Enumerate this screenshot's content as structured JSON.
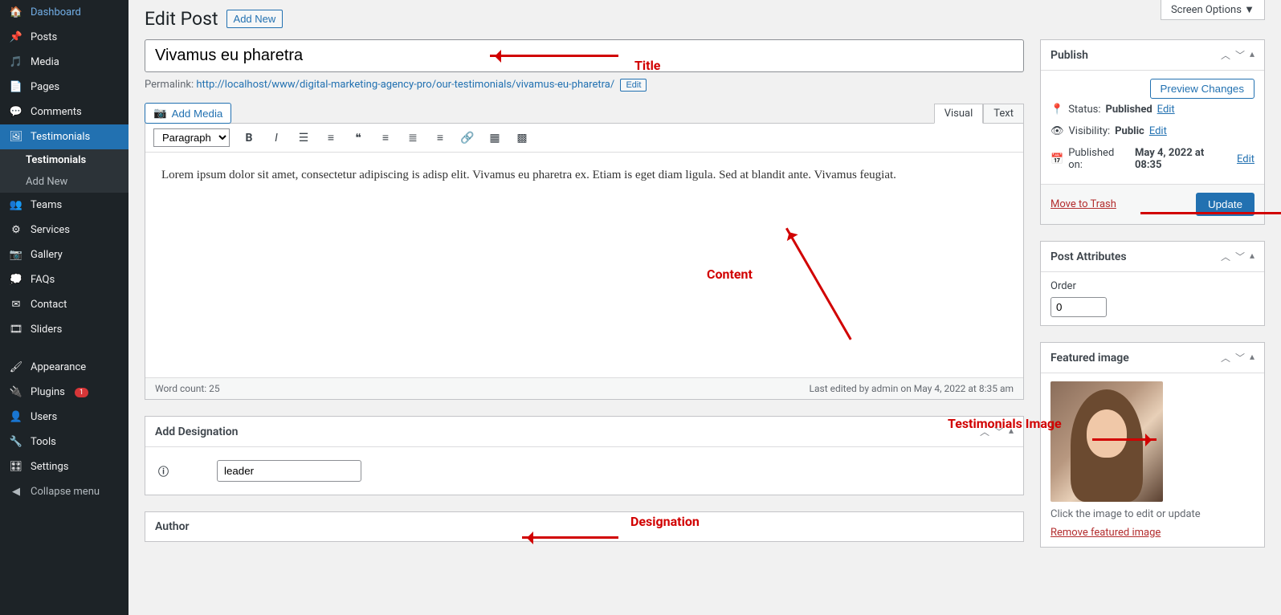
{
  "screen_options": "Screen Options ▼",
  "sidebar": {
    "items": [
      {
        "icon": "dash",
        "label": "Dashboard"
      },
      {
        "icon": "pin",
        "label": "Posts"
      },
      {
        "icon": "media",
        "label": "Media"
      },
      {
        "icon": "page",
        "label": "Pages"
      },
      {
        "icon": "comment",
        "label": "Comments"
      },
      {
        "icon": "test",
        "label": "Testimonials",
        "active": true
      },
      {
        "icon": "team",
        "label": "Teams"
      },
      {
        "icon": "serv",
        "label": "Services"
      },
      {
        "icon": "gall",
        "label": "Gallery"
      },
      {
        "icon": "faq",
        "label": "FAQs"
      },
      {
        "icon": "mail",
        "label": "Contact"
      },
      {
        "icon": "slide",
        "label": "Sliders"
      },
      {
        "icon": "appear",
        "label": "Appearance"
      },
      {
        "icon": "plugin",
        "label": "Plugins",
        "badge": "1"
      },
      {
        "icon": "user",
        "label": "Users"
      },
      {
        "icon": "tool",
        "label": "Tools"
      },
      {
        "icon": "set",
        "label": "Settings"
      }
    ],
    "submenu": [
      "Testimonials",
      "Add New"
    ],
    "collapse": "Collapse menu"
  },
  "header": {
    "title": "Edit Post",
    "add_new": "Add New"
  },
  "title_value": "Vivamus eu pharetra",
  "permalink": {
    "label": "Permalink:",
    "base": "http://localhost/www/digital-marketing-agency-pro/our-testimonials/",
    "slug": "vivamus-eu-pharetra",
    "trail": "/",
    "edit": "Edit"
  },
  "add_media": "Add Media",
  "editor_tabs": {
    "visual": "Visual",
    "text": "Text"
  },
  "paragraph_select": "Paragraph",
  "content_text": "Lorem ipsum dolor sit amet, consectetur adipiscing is adisp elit. Vivamus eu pharetra ex. Etiam is eget diam ligula. Sed at blandit ante. Vivamus feugiat.",
  "word_count": "Word count: 25",
  "last_edited": "Last edited by admin on May 4, 2022 at 8:35 am",
  "add_designation": {
    "title": "Add Designation",
    "value": "leader"
  },
  "author_box": "Author",
  "publish": {
    "title": "Publish",
    "preview": "Preview Changes",
    "status_label": "Status:",
    "status_value": "Published",
    "edit": "Edit",
    "visibility_label": "Visibility:",
    "visibility_value": "Public",
    "published_label": "Published on:",
    "published_value": "May 4, 2022 at 08:35",
    "trash": "Move to Trash",
    "update": "Update"
  },
  "post_attributes": {
    "title": "Post Attributes",
    "order_label": "Order",
    "order_value": "0"
  },
  "featured": {
    "title": "Featured image",
    "hint": "Click the image to edit or update",
    "remove": "Remove featured image"
  },
  "annotations": {
    "title": "Title",
    "content": "Content",
    "designation": "Designation",
    "img": "Testimonials Image"
  }
}
